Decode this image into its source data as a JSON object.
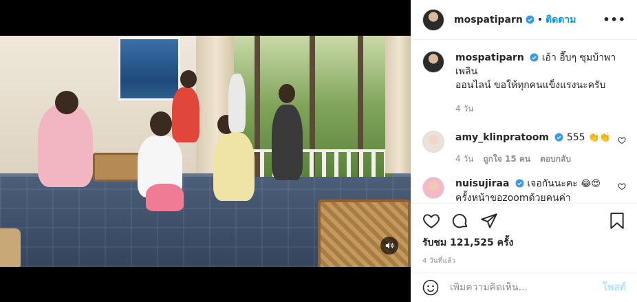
{
  "post": {
    "author": "mospatiparn",
    "follow_label": "ติดตาม",
    "more_label": "•••",
    "separator": "•"
  },
  "caption": {
    "author": "mospatiparn",
    "text_line1": "เอ้า อื๊บๆ ซุมบ้าพาเพลิน",
    "text_line2": "ออนไลน์ ขอให้ทุกคนแข็งแรงนะครับ",
    "time": "4 วัน"
  },
  "comments": [
    {
      "username": "amy_klinpratoom",
      "text": "555",
      "emoji": "👏👏",
      "time": "4 วัน",
      "likes": "ถูกใจ 15 คน",
      "reply": "ตอบกลับ"
    },
    {
      "username": "nuisujiraa",
      "text_line1": "เจอกันนะคะ",
      "emoji": "😂😍",
      "text_line2": "ครั้งหน้าขอzoomด้วยคนค่า"
    }
  ],
  "stats": {
    "views": "รับชม 121,525 ครั้ง",
    "ago": "4 วันที่แล้ว"
  },
  "add_comment": {
    "placeholder": "เพิ่มความคิดเห็น...",
    "post_label": "โพสต์"
  },
  "colors": {
    "accent": "#0095f6",
    "post_disabled": "#b2dffc",
    "muted": "#8e8e8e"
  },
  "icons": [
    "volume-icon",
    "verified-icon",
    "heart-icon",
    "comment-icon",
    "share-icon",
    "bookmark-icon",
    "emoji-icon",
    "more-icon"
  ]
}
